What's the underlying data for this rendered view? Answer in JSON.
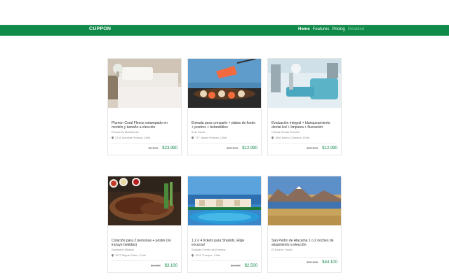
{
  "brand": "CUPPON",
  "nav": [
    {
      "label": "Home",
      "state": "active"
    },
    {
      "label": "Features",
      "state": "normal"
    },
    {
      "label": "Pricing",
      "state": "normal"
    },
    {
      "label": "Disabled",
      "state": "muted"
    }
  ],
  "cards": [
    {
      "title": "Plumon Coral Fleece estampado en modelo y tamaño a elección",
      "merchant": "Plumones Matrimonio",
      "address": "2741 Avenida Rosalía, Chile",
      "old_price": "$6.990",
      "new_price": "$23.990",
      "image": "bedroom-photo"
    },
    {
      "title": "Entrada para compartir + platos de fondo + postres + bebestibles",
      "merchant": "5 de Sushi",
      "address": "777 Jasaw Polman, Chile",
      "old_price": "$35.990",
      "new_price": "$12.990",
      "image": "sushi-photo"
    },
    {
      "title": "Evaluación integral + blanqueamiento dental led + limpieza + fluoración",
      "merchant": "Clínica Dental Sonrisa",
      "address": "1840 Barrio Cristóbal, Chile",
      "old_price": "$30.990",
      "new_price": "$12.990",
      "image": "dental-clinic-photo"
    },
    {
      "title": "Colación para 2 personas + postre (no incluye bebidas)",
      "merchant": "Sandwich Mirabal",
      "address": "1977 Miguel Claro, Chile",
      "old_price": "$4.990",
      "new_price": "$3.100",
      "image": "grilled-meat-photo"
    },
    {
      "title": "1,2 o 4 tickets para Shukids. Elige excursa!",
      "merchant": "Shukids Centro de Eventos",
      "address": "1010 Trenque, Chile",
      "old_price": "$4.990",
      "new_price": "$2.500",
      "image": "resort-pool-photo"
    },
    {
      "title": "San Pedro de Atacama 1 o 2 noches de alojamiento a elección",
      "merchant": "El Explorr Travel",
      "address": "",
      "old_price": "$80.990",
      "new_price": "$44.100",
      "image": "desert-lake-photo"
    }
  ],
  "colors": {
    "brand_green": "#0f8a49",
    "price_green": "#0f8a49"
  }
}
